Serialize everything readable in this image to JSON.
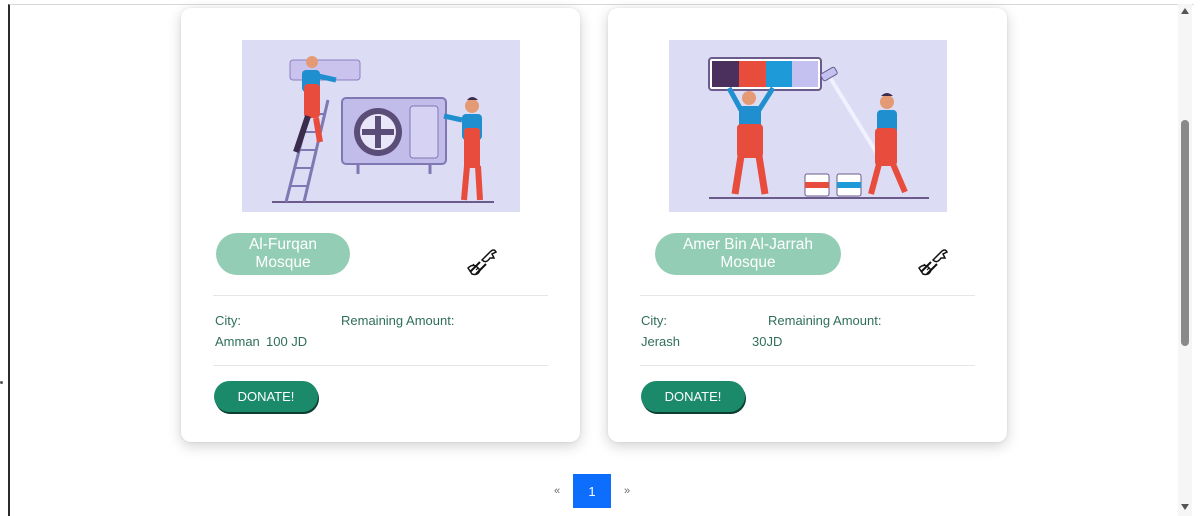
{
  "cards": [
    {
      "name": "Al-Furqan Mosque",
      "city_label": "City:",
      "remaining_label": "Remaining Amount:",
      "city_value": "Amman",
      "remaining_value": "100 JD",
      "donate_label": "DONATE!",
      "illustration_icon": "ac-repair-illustration",
      "category_icon": "wrench-hand-icon"
    },
    {
      "name": "Amer Bin Al-Jarrah Mosque",
      "city_label": "City:",
      "remaining_label": "Remaining Amount:",
      "city_value": "Jerash",
      "remaining_value": "30JD",
      "donate_label": "DONATE!",
      "illustration_icon": "painting-illustration",
      "category_icon": "wrench-hand-icon"
    }
  ],
  "pagination": {
    "prev": "«",
    "current": "1",
    "next": "»"
  },
  "colors": {
    "accent": "#1b8a6b",
    "pill": "#93cdb6",
    "text": "#2f6f58",
    "page_active": "#0d6efd"
  }
}
